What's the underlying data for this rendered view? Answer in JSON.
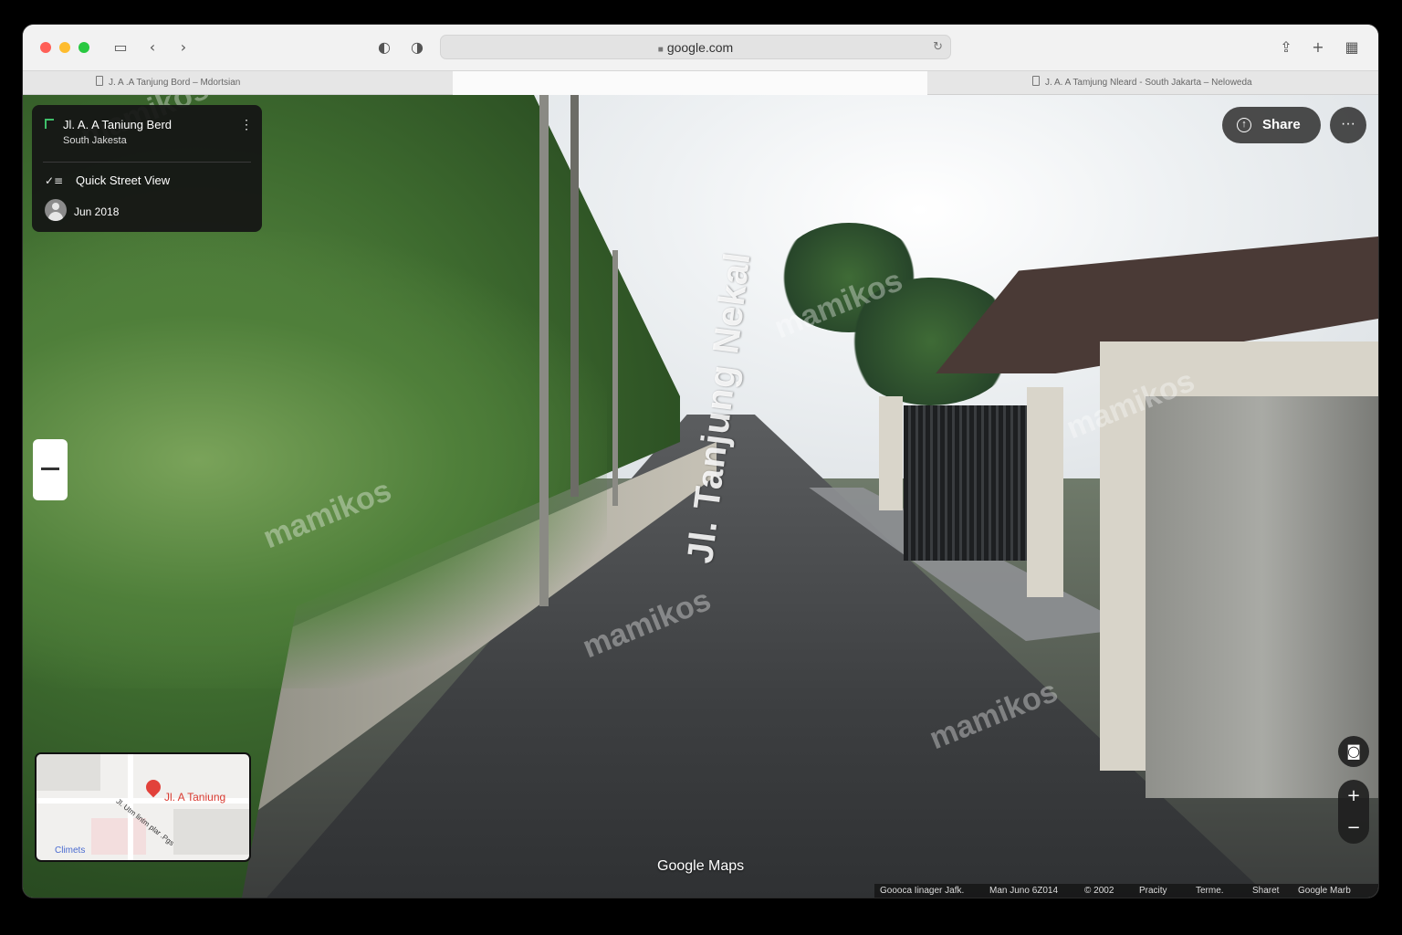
{
  "browser": {
    "url": "google.com",
    "tabs": [
      {
        "label": "J. A .A Tanjung Bord – Mdortsian",
        "active": false
      },
      {
        "label": "",
        "active": true
      },
      {
        "label": "J. A. A Tamjung Nleard  -  South Jakarta – Neloweda",
        "active": false
      }
    ]
  },
  "info_card": {
    "title": "Jl. A. A Taniung Berd",
    "subtitle": "South Jakesta",
    "quick_street_view": "Quick Street View",
    "date": "Jun 2018"
  },
  "street_label": "Jl. Tanjung Nekal",
  "watermark": "mamikos",
  "share_label": "Share",
  "more_label": "···",
  "minimap": {
    "place_label": "Jl. A Taniung",
    "street_label": "Jl. Utm lintm plar .Pgs",
    "brand": "Climets"
  },
  "footer": {
    "brand": "Google Maps",
    "attribution": [
      "Goooca Iinager Jafk.",
      "Man Juno 6Z014",
      "© 2002",
      "Pracity",
      "Terme.",
      "Sharet",
      "Google Marb"
    ]
  },
  "colors": {
    "pin_accent": "#e2413a",
    "info_pin": "#3fbf6a",
    "traffic_close": "#ff5f57",
    "traffic_min": "#febc2e",
    "traffic_max": "#28c840"
  }
}
